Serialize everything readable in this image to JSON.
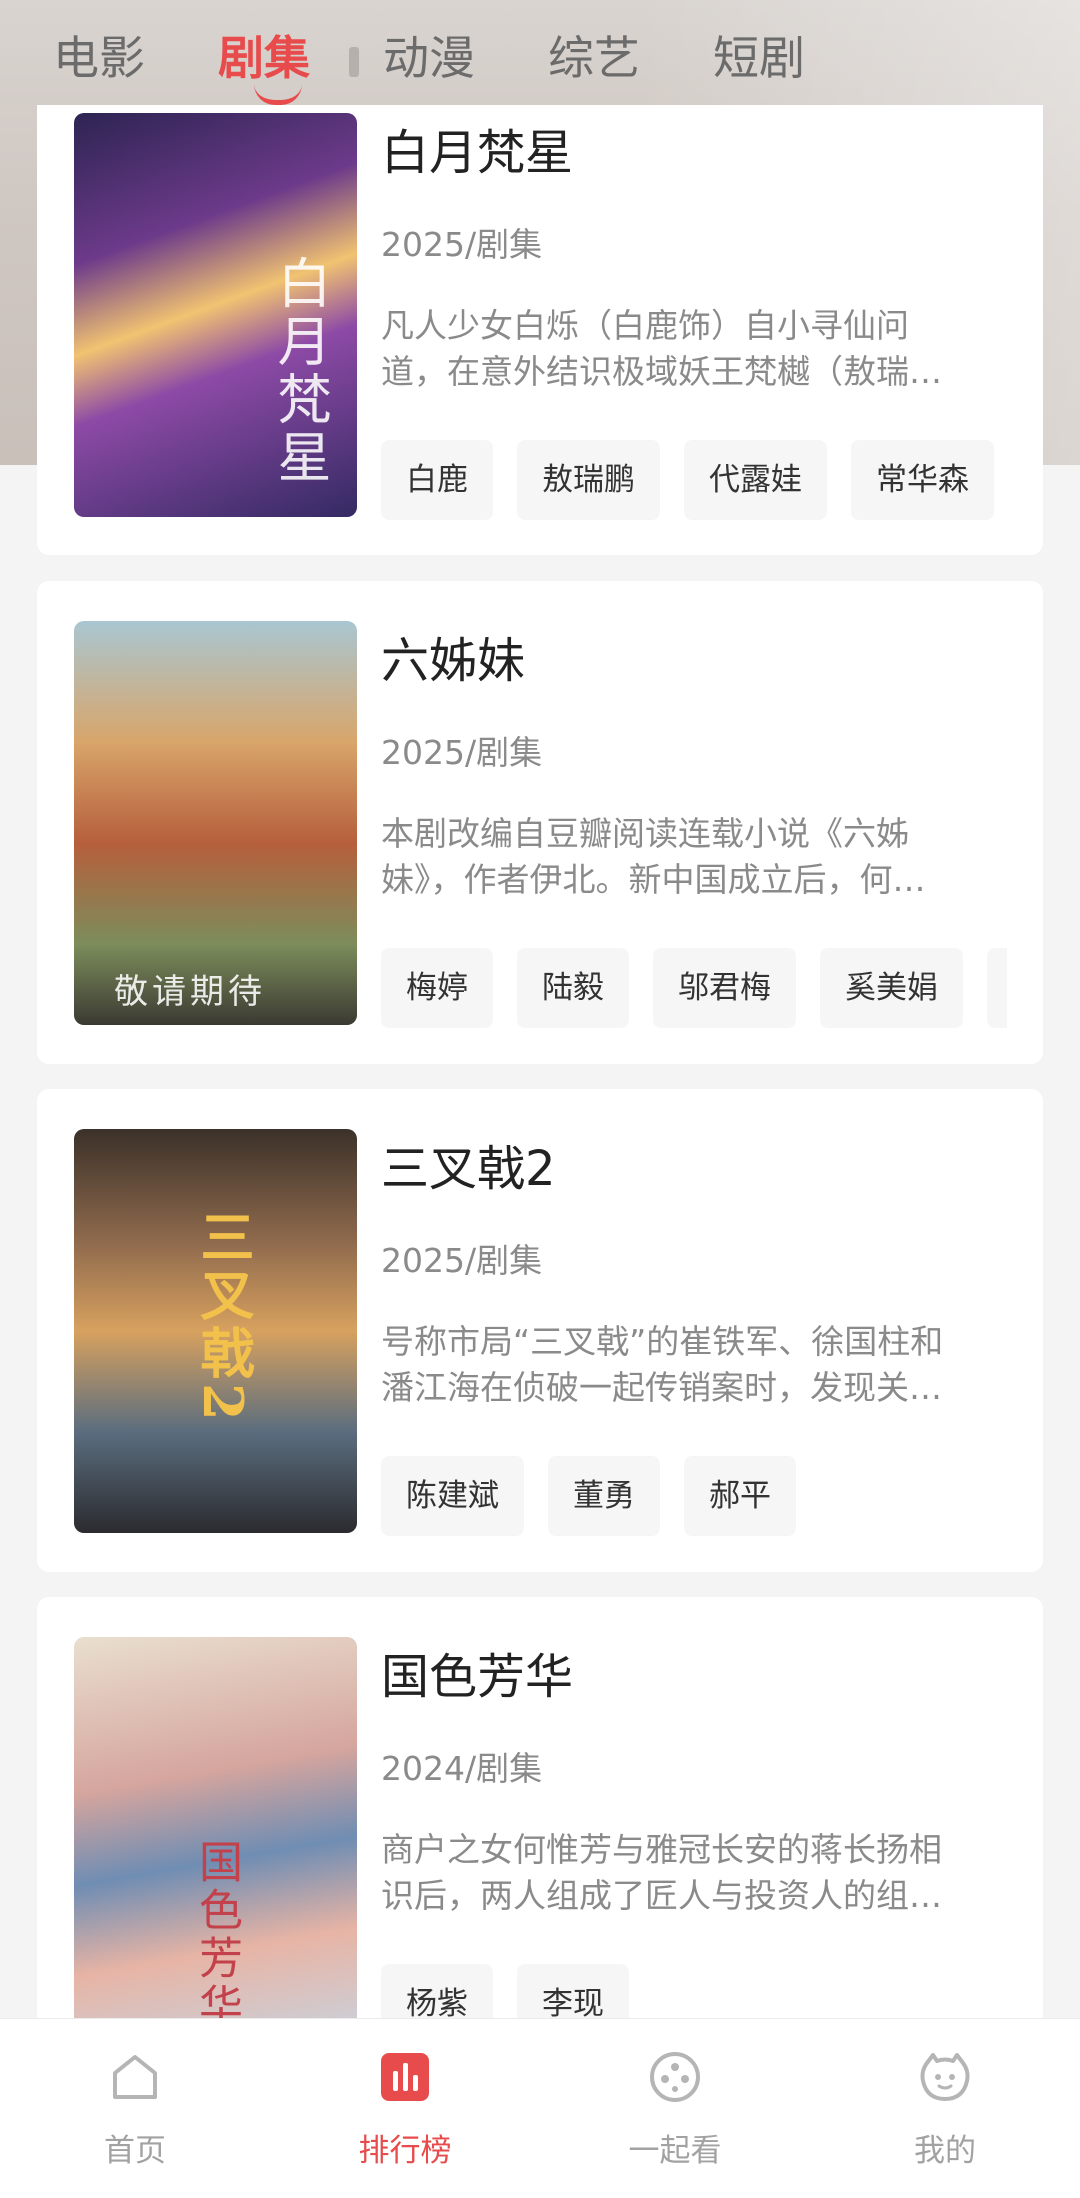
{
  "top_tabs": [
    "电影",
    "剧集",
    "动漫",
    "综艺",
    "短剧"
  ],
  "active_top_tab": "剧集",
  "accent_color": "#e84b4b",
  "cards": [
    {
      "title": "白月梵星",
      "meta": "2025/剧集",
      "desc_line1": "凡人少女白烁（白鹿饰）自小寻仙问",
      "desc_line2": "道，在意外结识极域妖王梵樾（敖瑞…",
      "chips": [
        "白鹿",
        "敖瑞鹏",
        "代露娃",
        "常华森"
      ],
      "poster_mark": "白月梵星"
    },
    {
      "title": "六姊妹",
      "meta": "2025/剧集",
      "desc_line1": "本剧改编自豆瓣阅读连载小说《六姊",
      "desc_line2": "妹》，作者伊北。新中国成立后，何…",
      "chips": [
        "梅婷",
        "陆毅",
        "邬君梅",
        "奚美娟"
      ],
      "poster_mark": "敬请期待"
    },
    {
      "title": "三叉戟2",
      "meta": "2025/剧集",
      "desc_line1": "号称市局“三叉戟”的崔铁军、徐国柱和",
      "desc_line2": "潘江海在侦破一起传销案时，发现关…",
      "chips": [
        "陈建斌",
        "董勇",
        "郝平"
      ],
      "poster_mark": "三叉戟2"
    },
    {
      "title": "国色芳华",
      "meta": "2024/剧集",
      "desc_line1": "商户之女何惟芳与雅冠长安的蒋长扬相",
      "desc_line2": "识后，两人组成了匠人与投资人的组…",
      "chips": [
        "杨紫",
        "李现"
      ],
      "poster_mark": "国色芳华"
    }
  ],
  "bottom_tabs": [
    {
      "label": "首页",
      "icon": "home-icon"
    },
    {
      "label": "排行榜",
      "icon": "ranking-icon"
    },
    {
      "label": "一起看",
      "icon": "film-reel-icon"
    },
    {
      "label": "我的",
      "icon": "profile-face-icon"
    }
  ],
  "active_bottom_tab": "排行榜"
}
